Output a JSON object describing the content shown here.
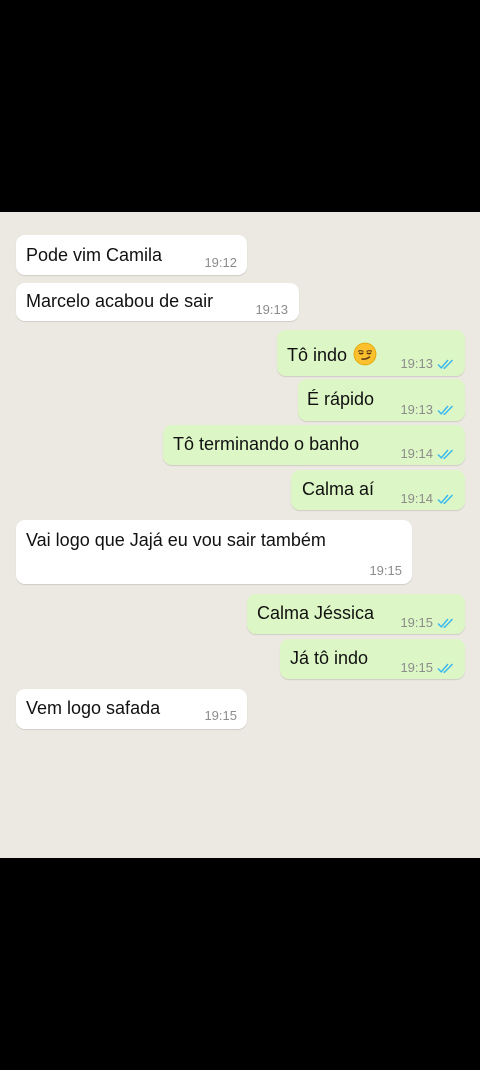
{
  "colors": {
    "incoming_bubble": "#ffffff",
    "outgoing_bubble": "#dcf7c5",
    "chat_bg": "#ece9e2",
    "read_ticks": "#34b7f1"
  },
  "messages": [
    {
      "dir": "in",
      "text": "Pode vim Camila",
      "time": "19:12"
    },
    {
      "dir": "in",
      "text": "Marcelo acabou de sair",
      "time": "19:13"
    },
    {
      "dir": "out",
      "text": "Tô indo",
      "time": "19:13",
      "emoji": "smirking-face",
      "status": "read"
    },
    {
      "dir": "out",
      "text": "É rápido",
      "time": "19:13",
      "status": "read"
    },
    {
      "dir": "out",
      "text": "Tô terminando o banho",
      "time": "19:14",
      "status": "read"
    },
    {
      "dir": "out",
      "text": "Calma aí",
      "time": "19:14",
      "status": "read"
    },
    {
      "dir": "in",
      "text": "Vai logo que Jajá eu vou sair também",
      "time": "19:15"
    },
    {
      "dir": "out",
      "text": "Calma Jéssica",
      "time": "19:15",
      "status": "read"
    },
    {
      "dir": "out",
      "text": "Já tô indo",
      "time": "19:15",
      "status": "read"
    },
    {
      "dir": "in",
      "text": "Vem logo safada",
      "time": "19:15"
    }
  ]
}
